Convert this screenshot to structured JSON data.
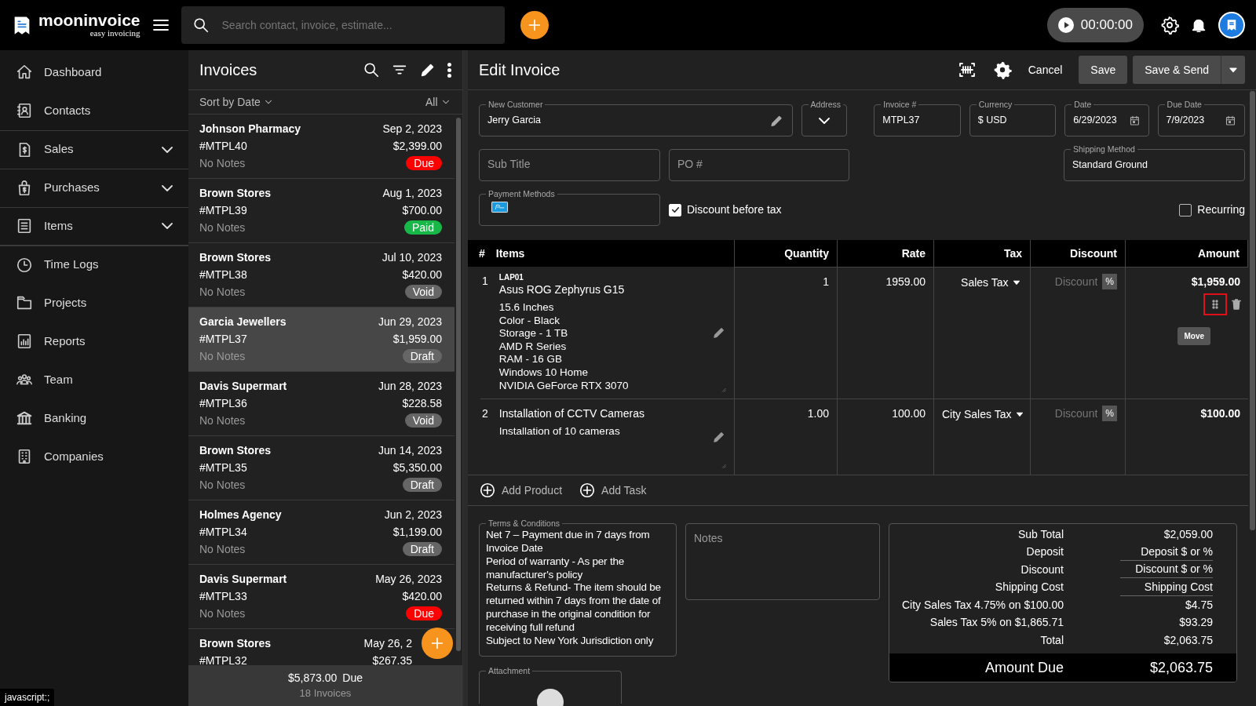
{
  "app": {
    "logo_name": "mooninvoice",
    "logo_tagline": "easy invoicing"
  },
  "search": {
    "placeholder": "Search contact, invoice, estimate..."
  },
  "timer": {
    "text": "00:00:00"
  },
  "sidebar": {
    "items": [
      {
        "label": "Dashboard",
        "expandable": false
      },
      {
        "label": "Contacts",
        "expandable": false
      },
      {
        "label": "Sales",
        "expandable": true
      },
      {
        "label": "Purchases",
        "expandable": true
      },
      {
        "label": "Items",
        "expandable": true
      },
      {
        "label": "Time Logs",
        "expandable": false
      },
      {
        "label": "Projects",
        "expandable": false
      },
      {
        "label": "Reports",
        "expandable": false
      },
      {
        "label": "Team",
        "expandable": false
      },
      {
        "label": "Banking",
        "expandable": false
      },
      {
        "label": "Companies",
        "expandable": false
      }
    ]
  },
  "invoices": {
    "title": "Invoices",
    "sort": "Sort by Date",
    "filter": "All",
    "items": [
      {
        "customer": "Johnson Pharmacy",
        "date": "Sep 2, 2023",
        "number": "#MTPL40",
        "amount": "$2,399.00",
        "notes": "No Notes",
        "status": "Due",
        "color": "#ff0000",
        "selected": false
      },
      {
        "customer": "Brown Stores",
        "date": "Aug 1, 2023",
        "number": "#MTPL39",
        "amount": "$700.00",
        "notes": "No Notes",
        "status": "Paid",
        "color": "#18b848",
        "selected": false
      },
      {
        "customer": "Brown Stores",
        "date": "Jul 10, 2023",
        "number": "#MTPL38",
        "amount": "$420.00",
        "notes": "No Notes",
        "status": "Void",
        "color": "#666666",
        "selected": false
      },
      {
        "customer": "Garcia Jewellers",
        "date": "Jun 29, 2023",
        "number": "#MTPL37",
        "amount": "$1,959.00",
        "notes": "No Notes",
        "status": "Draft",
        "color": "#666666",
        "selected": true
      },
      {
        "customer": "Davis Supermart",
        "date": "Jun 28, 2023",
        "number": "#MTPL36",
        "amount": "$228.58",
        "notes": "No Notes",
        "status": "Void",
        "color": "#666666",
        "selected": false
      },
      {
        "customer": "Brown Stores",
        "date": "Jun 14, 2023",
        "number": "#MTPL35",
        "amount": "$5,350.00",
        "notes": "No Notes",
        "status": "Draft",
        "color": "#666666",
        "selected": false
      },
      {
        "customer": "Holmes Agency",
        "date": "Jun 2, 2023",
        "number": "#MTPL34",
        "amount": "$1,199.00",
        "notes": "No Notes",
        "status": "Draft",
        "color": "#666666",
        "selected": false
      },
      {
        "customer": "Davis Supermart",
        "date": "May 26, 2023",
        "number": "#MTPL33",
        "amount": "$420.00",
        "notes": "No Notes",
        "status": "Due",
        "color": "#ff0000",
        "selected": false
      },
      {
        "customer": "Brown Stores",
        "date": "May 26, 2",
        "number": "#MTPL32",
        "amount": "$267.35",
        "selected": false
      }
    ],
    "footer_total": "$5,873.00",
    "footer_due": "Due",
    "footer_count": "18 Invoices"
  },
  "edit": {
    "title": "Edit Invoice",
    "cancel": "Cancel",
    "save": "Save",
    "save_send": "Save & Send",
    "customer": {
      "label": "New Customer",
      "value": "Jerry Garcia"
    },
    "address": {
      "label": "Address"
    },
    "invoice_number": {
      "label": "Invoice #",
      "value": "MTPL37"
    },
    "currency": {
      "label": "Currency",
      "value": "$ USD"
    },
    "date": {
      "label": "Date",
      "value": "6/29/2023"
    },
    "due_date": {
      "label": "Due Date",
      "value": "7/9/2023"
    },
    "subtitle": {
      "placeholder": "Sub Title"
    },
    "po": {
      "placeholder": "PO #"
    },
    "shipping": {
      "label": "Shipping Method",
      "value": "Standard Ground"
    },
    "payment_methods": {
      "label": "Payment Methods"
    },
    "discount_before_tax": {
      "label": "Discount before tax",
      "checked": true
    },
    "recurring": {
      "label": "Recurring",
      "checked": false
    }
  },
  "table": {
    "columns": [
      "#",
      "Items",
      "Quantity",
      "Rate",
      "Tax",
      "Discount",
      "Amount"
    ],
    "rows": [
      {
        "number": "1",
        "code": "LAP01",
        "name": "Asus ROG Zephyrus G15",
        "description": "15.6 Inches\nColor - Black\nStorage - 1 TB\nAMD R Series\nRAM - 16 GB\nWindows 10 Home\nNVIDIA GeForce RTX 3070",
        "quantity": "1",
        "rate": "1959.00",
        "tax": "Sales Tax",
        "discount_placeholder": "Discount",
        "discount_unit": "%",
        "amount": "$1,959.00",
        "hovered": true,
        "tooltip": "Move"
      },
      {
        "number": "2",
        "name": "Installation of CCTV Cameras",
        "description": "Installation of 10 cameras",
        "quantity": "1.00",
        "rate": "100.00",
        "tax": "City Sales Tax",
        "discount_placeholder": "Discount",
        "discount_unit": "%",
        "amount": "$100.00",
        "hovered": false
      }
    ],
    "add_product": "Add Product",
    "add_task": "Add Task"
  },
  "terms": {
    "label": "Terms & Conditions",
    "text": "Net 7 – Payment due in 7 days from Invoice Date\nPeriod of warranty - As per the manufacturer's policy\nReturns & Refund- The item should be returned within 7 days from the date of purchase in the original condition for receiving full refund\nSubject to New York Jurisdiction only"
  },
  "notes": {
    "placeholder": "Notes"
  },
  "attachment": {
    "label": "Attachment"
  },
  "summary": {
    "rows": [
      {
        "kind": "text",
        "label": "Sub Total",
        "value": "$2,059.00"
      },
      {
        "kind": "input",
        "label": "Deposit",
        "placeholder": "Deposit $ or %"
      },
      {
        "kind": "input",
        "label": "Discount",
        "placeholder": "Discount $ or %"
      },
      {
        "kind": "input",
        "label": "Shipping Cost",
        "placeholder": "Shipping Cost"
      },
      {
        "kind": "text",
        "label": "City Sales Tax 4.75% on $100.00",
        "value": "$4.75"
      },
      {
        "kind": "text",
        "label": "Sales Tax 5% on $1,865.71",
        "value": "$93.29"
      },
      {
        "kind": "text",
        "label": "Total",
        "value": "$2,063.75"
      }
    ],
    "amount_due": {
      "label": "Amount Due",
      "value": "$2,063.75"
    }
  },
  "status_bar": "javascript:;"
}
